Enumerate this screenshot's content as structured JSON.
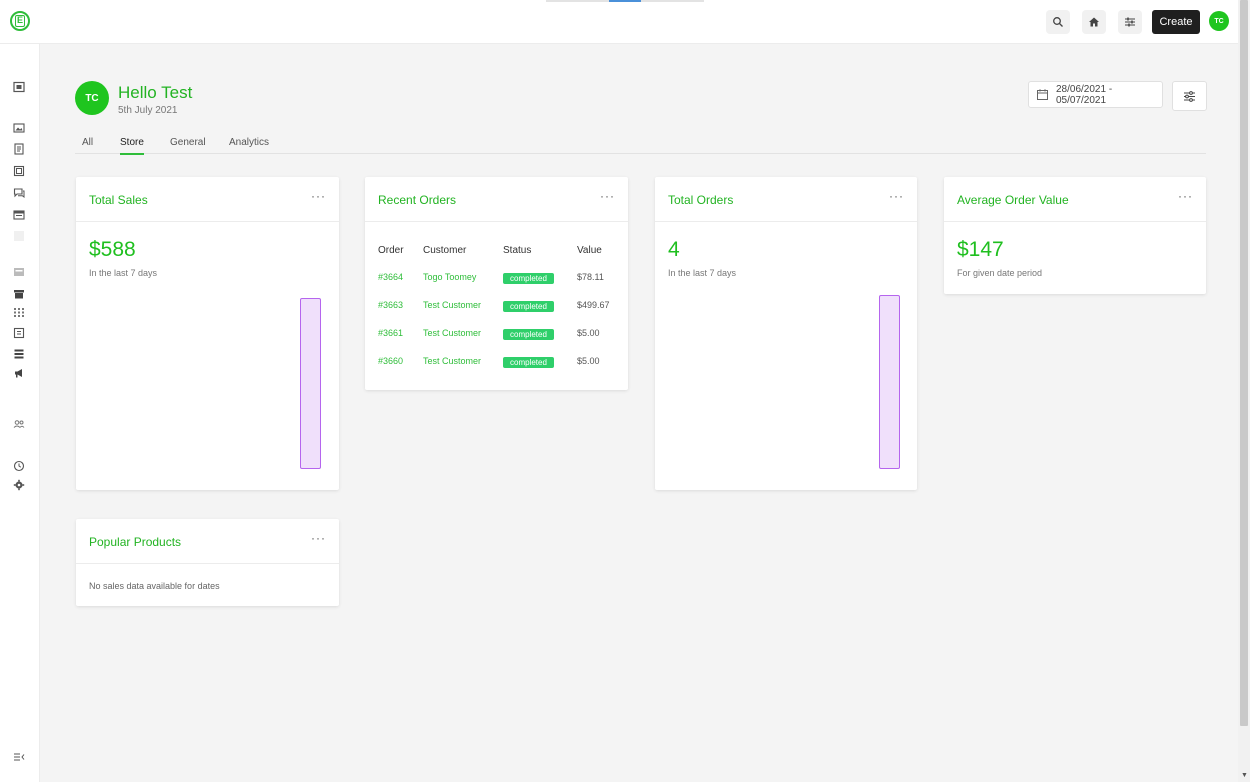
{
  "header": {
    "create_label": "Create",
    "avatar_initials": "TC"
  },
  "colors": {
    "accent": "#1fbf1f",
    "bar_fill": "#f0e0fb",
    "bar_border": "#b565ee",
    "status_badge": "#2fcf6a"
  },
  "sidebar_icons": [
    "dashboard-icon",
    "media-icon",
    "pages-icon",
    "gallery-icon",
    "comments-icon",
    "forms-icon",
    "store-icon",
    "products-icon",
    "grid-icon",
    "reports-icon",
    "list-icon",
    "marketing-icon",
    "users-icon",
    "history-icon",
    "settings-icon",
    "collapse-icon"
  ],
  "profile": {
    "initials": "TC",
    "greeting": "Hello Test",
    "date": "5th July 2021"
  },
  "date_range": "28/06/2021 - 05/07/2021",
  "tabs": [
    {
      "label": "All",
      "active": false
    },
    {
      "label": "Store",
      "active": true
    },
    {
      "label": "General",
      "active": false
    },
    {
      "label": "Analytics",
      "active": false
    }
  ],
  "cards": {
    "total_sales": {
      "title": "Total Sales",
      "menu": "···",
      "value": "$588",
      "subtitle": "In the last 7 days",
      "bar_fraction": 1.0
    },
    "recent_orders": {
      "title": "Recent Orders",
      "menu": "···",
      "columns": [
        "Order",
        "Customer",
        "Status",
        "Value"
      ],
      "rows": [
        {
          "order": "#3664",
          "customer": "Togo Toomey",
          "status": "completed",
          "value": "$78.11"
        },
        {
          "order": "#3663",
          "customer": "Test Customer",
          "status": "completed",
          "value": "$499.67"
        },
        {
          "order": "#3661",
          "customer": "Test Customer",
          "status": "completed",
          "value": "$5.00"
        },
        {
          "order": "#3660",
          "customer": "Test Customer",
          "status": "completed",
          "value": "$5.00"
        }
      ]
    },
    "total_orders": {
      "title": "Total Orders",
      "menu": "···",
      "value": "4",
      "subtitle": "In the last 7 days",
      "bar_fraction": 1.0
    },
    "average_order_value": {
      "title": "Average Order Value",
      "menu": "···",
      "value": "$147",
      "subtitle": "For given date period"
    },
    "popular_products": {
      "title": "Popular Products",
      "menu": "···",
      "empty_message": "No sales data available for dates"
    }
  }
}
